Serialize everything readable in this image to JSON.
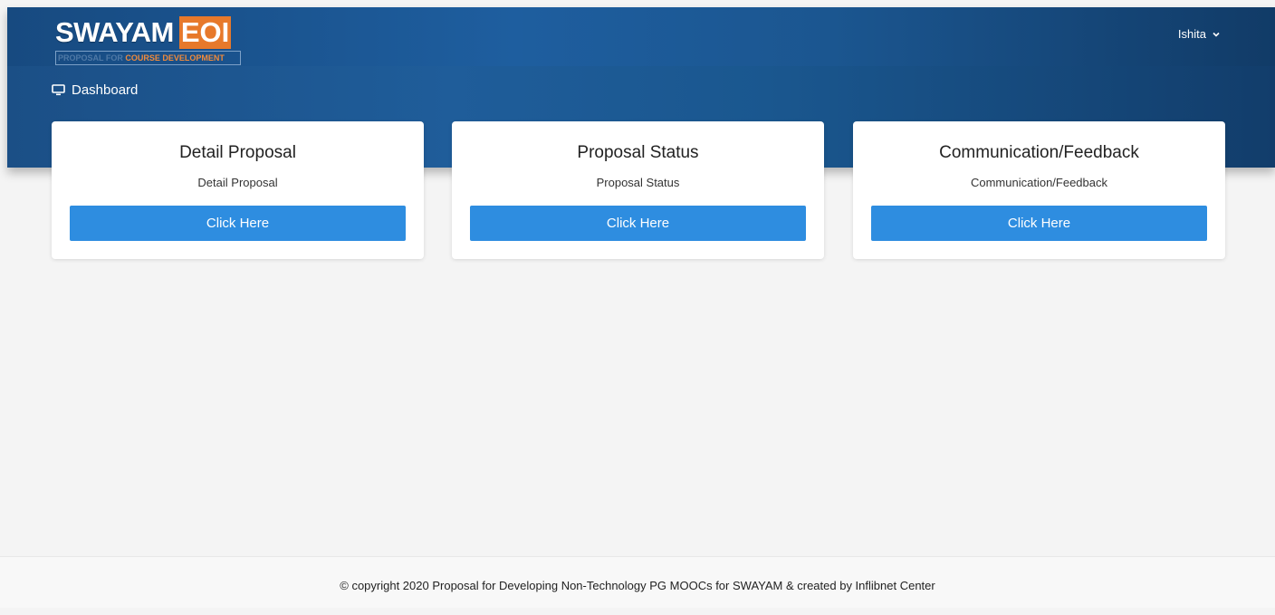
{
  "header": {
    "logo": {
      "main": "SWAYAM",
      "accent": "EOI",
      "tagline_part1": "PROPOSAL FOR ",
      "tagline_part2": "COURSE DEVELOPMENT"
    },
    "user_name": "Ishita",
    "user_menu_icon": "chevron-down-icon"
  },
  "breadcrumb": {
    "icon": "monitor-icon",
    "label": "Dashboard"
  },
  "cards": [
    {
      "title": "Detail Proposal",
      "subtitle": "Detail Proposal",
      "button": "Click Here"
    },
    {
      "title": "Proposal Status",
      "subtitle": "Proposal Status",
      "button": "Click Here"
    },
    {
      "title": "Communication/Feedback",
      "subtitle": "Communication/Feedback",
      "button": "Click Here"
    }
  ],
  "footer": {
    "text": "© copyright 2020 Proposal for Developing Non-Technology PG MOOCs for SWAYAM & created by Inflibnet Center"
  },
  "colors": {
    "header_blue": "#1e5e9f",
    "button_blue": "#2e8de0",
    "logo_orange": "#e7792b",
    "background": "#f4f4f4"
  }
}
